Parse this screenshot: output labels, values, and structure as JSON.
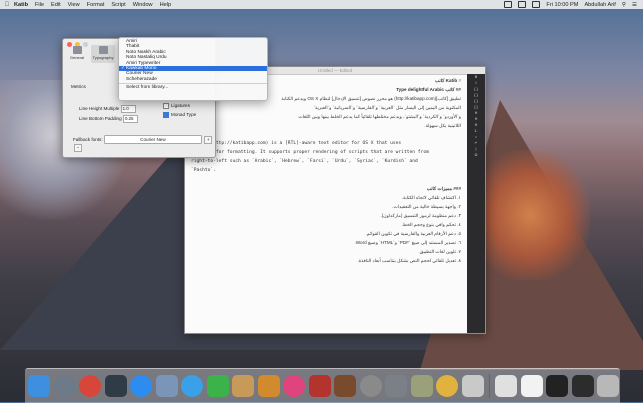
{
  "menubar": {
    "apple_icon": "apple-icon",
    "app_name": "Katib",
    "menus": [
      "File",
      "Edit",
      "View",
      "Format",
      "Script",
      "Window",
      "Help"
    ],
    "clock": "Fri 10:00 PM",
    "user": "Abdullah Arif"
  },
  "prefs": {
    "tabs": [
      {
        "label": "General",
        "icon": "gear-icon"
      },
      {
        "label": "Typography",
        "icon": "typography-icon"
      }
    ],
    "metrics_label": "Metrics",
    "line_height_label": "Line Height Multiple",
    "line_height_value": "1.0",
    "line_bottom_label": "Line Bottom Padding",
    "line_bottom_value": "0.25",
    "ligatures_label": "Ligatures",
    "mono_type_label": "Monad Type",
    "fallback_label": "Fallback fonts:",
    "fallback_value": "Courier New",
    "add_label": "+",
    "remove_label": "−"
  },
  "font_menu": {
    "items": [
      "Amiri",
      "Thabit",
      "Noto Naskh Arabic",
      "Noto Nastaliq Urdu",
      "Amiri Typewriter",
      "Kawkab Mono",
      "Courier New",
      "Scheherazade"
    ],
    "selected_index": 5,
    "footer": "Select from library..."
  },
  "editor": {
    "title": "Untitled — Edited",
    "heading": "Katib  كاتب",
    "heading_hash": "#",
    "arabic_lines": [
      "## كاتب Type delightful Arabic",
      "تطبيق [كاتب](http://katibapp.com) هو محرر نصوص [تنسيق الإدخال] لنظام OS X ويدعم الكتابة",
      "المكتوبة من اليمين إلى اليسار مثل `العربية` و`الفارسية` و`السريانية` و`العبرية`",
      "و`الأوردو` و`الكردية` و`البشتو`، ويدعم مختلطها تلقائياً كما يدعم الخلط بينها وبين اللغات",
      "اللاتينية بكل سهولة."
    ],
    "english_lines": [
      "[Katib](http://katibapp.com) is a [RTL]-aware text editor for OS X that uses",
      "Markdown for formatting. It supports proper rendering of scripts that are written from",
      "right-to-left such as `Arabic`, `Hebrew`, `Farsi`, `Urdu`, `Syriac`, `Kurdish` and",
      "`Pashto`."
    ],
    "features_heading": "### مميزات كاتب",
    "features": [
      "١. اكتشاف تلقائي لاتجاه الكتابة.",
      "٢. واجهة بسيطة خالية من التعقيدات.",
      "٣. دعم منظومة لرموز التنسيق (ماركداون).",
      "٤. تحكم وافي بنوع وحجم الخط.",
      "٥. دعم الأرقام العربية والفارسية في تكوين القوائم.",
      "٦. تصدير المستند إلى صيغ `PDF` و`HTML` وصيغ Word.",
      "٧. تلوين لغات التطبيق.",
      "٨. تعديل تلقائي لحجم النص بشكل يتناسب أبعاد النافذة."
    ],
    "sidebar_labels": [
      "B",
      "I",
      "{ }",
      "{ }",
      "{ }",
      "[ ]",
      "H",
      "H",
      "H",
      "1.",
      "•",
      "↵",
      "|",
      "Ω"
    ]
  },
  "dock": {
    "apps": [
      {
        "name": "finder-icon",
        "color": "#3f8fe0"
      },
      {
        "name": "launchpad-icon",
        "color": "#6c7a8a"
      },
      {
        "name": "chrome-icon",
        "color": "#d8463a"
      },
      {
        "name": "mission-control-icon",
        "color": "#2f3b46"
      },
      {
        "name": "app-store-icon",
        "color": "#2d8cf0"
      },
      {
        "name": "preview-icon",
        "color": "#7b95b8"
      },
      {
        "name": "safari-icon",
        "color": "#3aa0e8"
      },
      {
        "name": "facetime-icon",
        "color": "#3cb34a"
      },
      {
        "name": "notes-icon",
        "color": "#c79a5a"
      },
      {
        "name": "ibooks-icon",
        "color": "#d18a2e"
      },
      {
        "name": "itunes-icon",
        "color": "#e0447c"
      },
      {
        "name": "photo-booth-icon",
        "color": "#b3342c"
      },
      {
        "name": "dictionary-icon",
        "color": "#7a4a2c"
      },
      {
        "name": "no-entry-icon",
        "color": "#8a8a8a"
      },
      {
        "name": "system-preferences-icon",
        "color": "#7a7f88"
      },
      {
        "name": "script-editor-icon",
        "color": "#9aa07a"
      },
      {
        "name": "photos-icon",
        "color": "#e2b23e"
      },
      {
        "name": "keyboard-icon",
        "color": "#c9c9c9"
      }
    ],
    "docs": [
      {
        "name": "printer-icon",
        "color": "#e0e0e0"
      },
      {
        "name": "document-icon",
        "color": "#f2f2f2"
      },
      {
        "name": "terminal-icon",
        "color": "#222"
      },
      {
        "name": "window-icon",
        "color": "#2c2c2c"
      },
      {
        "name": "trash-icon",
        "color": "#b8b8b8"
      }
    ]
  }
}
